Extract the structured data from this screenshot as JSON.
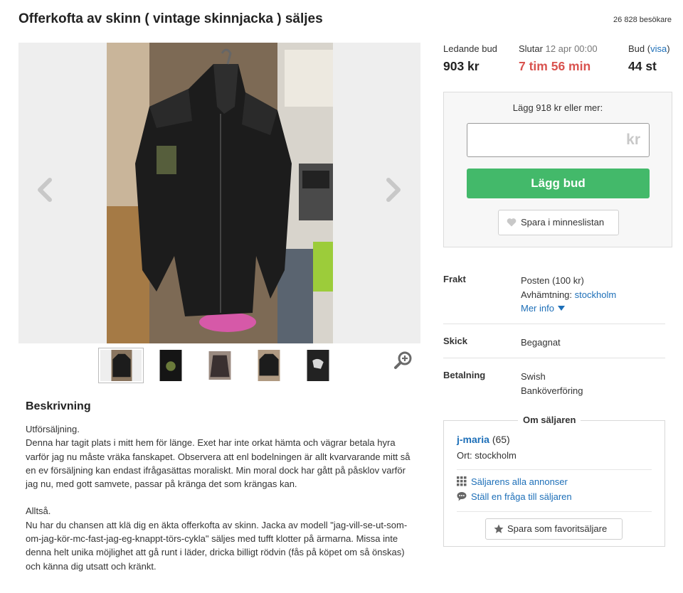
{
  "listing": {
    "title": "Offerkofta av skinn ( vintage skinnjacka ) säljes",
    "visitors": "26 828 besökare"
  },
  "gallery": {
    "thumbnail_count": 5,
    "active_thumbnail": 1
  },
  "bidding": {
    "leading_bid_label": "Ledande bud",
    "leading_bid_value": "903 kr",
    "ends_label": "Slutar",
    "ends_date": "12 apr 00:00",
    "ends_value": "7 tim 56 min",
    "bids_label": "Bud",
    "bids_link": "visa",
    "bids_value": "44 st",
    "hint": "Lägg 918 kr eller mer:",
    "input_value": "",
    "unit": "kr",
    "bid_button": "Lägg bud",
    "save_button": "Spara i minneslistan",
    "colors": {
      "bid_button": "#43b96a",
      "time_left": "#d9534f",
      "link": "#1d6fb8"
    }
  },
  "details": {
    "shipping_label": "Frakt",
    "shipping_post": "Posten (100 kr)",
    "pickup_prefix": "Avhämtning:",
    "pickup_city": "stockholm",
    "more_info": "Mer info",
    "condition_label": "Skick",
    "condition_value": "Begagnat",
    "payment_label": "Betalning",
    "payment_methods": [
      "Swish",
      "Banköverföring"
    ]
  },
  "seller": {
    "section_title": "Om säljaren",
    "name": "j-maria",
    "rating": "(65)",
    "location": "Ort: stockholm",
    "all_listings": "Säljarens alla annonser",
    "ask_question": "Ställ en fråga till säljaren",
    "favorite_button": "Spara som favoritsäljare"
  },
  "description": {
    "title": "Beskrivning",
    "paragraph_1": "Utförsäljning.\nDenna har tagit plats i mitt hem för länge. Exet har inte orkat hämta och vägrar betala hyra varför jag nu måste vräka fanskapet. Observera att enl bodelningen är allt kvarvarande mitt så en ev försäljning kan endast ifrågasättas moraliskt. Min moral dock har gått på påsklov varför jag nu, med gott samvete, passar på kränga det som krängas kan.",
    "paragraph_2": "Alltså.\nNu har du chansen att klä dig en äkta offerkofta av skinn. Jacka av modell \"jag-vill-se-ut-som-om-jag-kör-mc-fast-jag-eg-knappt-törs-cykla\" säljes med tufft klotter på ärmarna. Missa inte denna helt unika möjlighet att gå runt i läder, dricka billigt rödvin (fås på köpet om så önskas) och känna dig utsatt och kränkt."
  }
}
